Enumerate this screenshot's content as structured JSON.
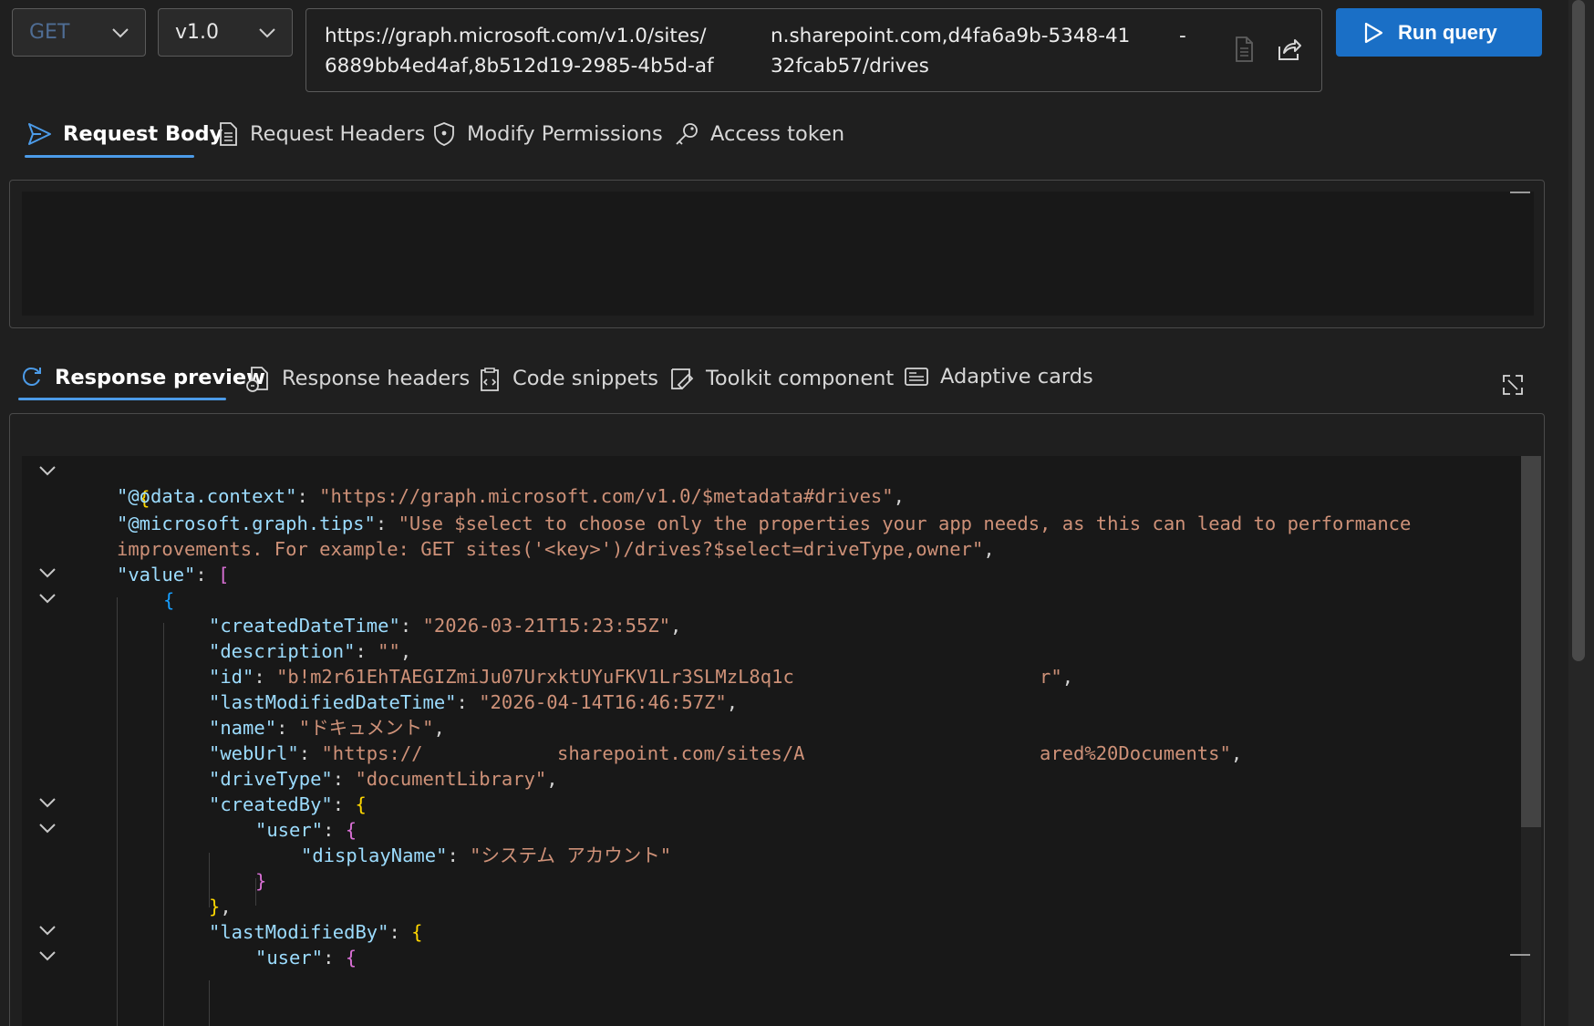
{
  "query_bar": {
    "method": "GET",
    "version": "v1.0",
    "url_line1_part1": "https://graph.microsoft.com/v1.0/sites/",
    "url_line1_part2": "n.sharepoint.com,d4fa6a9b-5348-41",
    "url_line1_part3": "-",
    "url_line2_part1": "6889bb4ed4af,8b512d19-2985-4b5d-af",
    "url_line2_part2": "32fcab57/drives",
    "run_label": "Run query"
  },
  "request_tabs": [
    {
      "label": "Request Body",
      "icon": "send-icon"
    },
    {
      "label": "Request Headers",
      "icon": "document-icon"
    },
    {
      "label": "Modify Permissions",
      "icon": "shield-icon"
    },
    {
      "label": "Access token",
      "icon": "key-icon"
    }
  ],
  "response_tabs": [
    {
      "label": "Response preview",
      "icon": "refresh-icon"
    },
    {
      "label": "Response headers",
      "icon": "document-icon"
    },
    {
      "label": "Code snippets",
      "icon": "clipboard-code-icon"
    },
    {
      "label": "Toolkit component",
      "icon": "toolkit-icon"
    },
    {
      "label": "Adaptive cards",
      "icon": "card-icon"
    }
  ],
  "response_json": {
    "open_brace": "{",
    "context_key": "\"@odata.context\"",
    "context_value": "\"https://graph.microsoft.com/v1.0/$metadata#drives\"",
    "tips_key": "\"@microsoft.graph.tips\"",
    "tips_value_1": "\"Use $select to choose only the properties your app needs, as this can lead to performance",
    "tips_value_2": "improvements. For example: GET sites('<key>')/drives?$select=driveType,owner\"",
    "value_key": "\"value\"",
    "created_key": "\"createdDateTime\"",
    "created_value": "\"2026-03-21T15:23:55Z\"",
    "desc_key": "\"description\"",
    "desc_value": "\"\"",
    "id_key": "\"id\"",
    "id_value_1": "\"b!m2r61EhTAEGIZmiJu07UrxktUYuFKV1Lr3SLMzL8q1c",
    "id_value_2": "r\"",
    "lastmod_key": "\"lastModifiedDateTime\"",
    "lastmod_value": "\"2026-04-14T16:46:57Z\"",
    "name_key": "\"name\"",
    "name_value": "\"ドキュメント\"",
    "weburl_key": "\"webUrl\"",
    "weburl_value_1": "\"https://",
    "weburl_value_2": "sharepoint.com/sites/A",
    "weburl_value_3": "ared%20Documents\"",
    "drivetype_key": "\"driveType\"",
    "drivetype_value": "\"documentLibrary\"",
    "createdby_key": "\"createdBy\"",
    "user_key": "\"user\"",
    "displayname_key": "\"displayName\"",
    "displayname_value": "\"システム アカウント\"",
    "lastmodby_key": "\"lastModifiedBy\""
  }
}
